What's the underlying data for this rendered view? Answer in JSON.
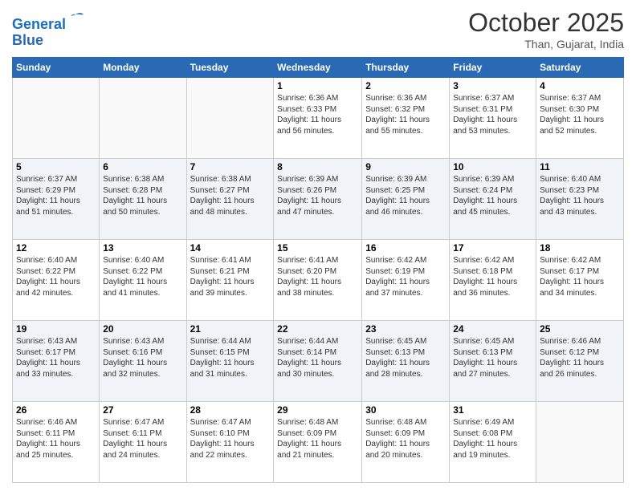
{
  "header": {
    "logo_line1": "General",
    "logo_line2": "Blue",
    "month_title": "October 2025",
    "location": "Than, Gujarat, India"
  },
  "days_of_week": [
    "Sunday",
    "Monday",
    "Tuesday",
    "Wednesday",
    "Thursday",
    "Friday",
    "Saturday"
  ],
  "weeks": [
    [
      {
        "day": "",
        "content": ""
      },
      {
        "day": "",
        "content": ""
      },
      {
        "day": "",
        "content": ""
      },
      {
        "day": "1",
        "content": "Sunrise: 6:36 AM\nSunset: 6:33 PM\nDaylight: 11 hours and 56 minutes."
      },
      {
        "day": "2",
        "content": "Sunrise: 6:36 AM\nSunset: 6:32 PM\nDaylight: 11 hours and 55 minutes."
      },
      {
        "day": "3",
        "content": "Sunrise: 6:37 AM\nSunset: 6:31 PM\nDaylight: 11 hours and 53 minutes."
      },
      {
        "day": "4",
        "content": "Sunrise: 6:37 AM\nSunset: 6:30 PM\nDaylight: 11 hours and 52 minutes."
      }
    ],
    [
      {
        "day": "5",
        "content": "Sunrise: 6:37 AM\nSunset: 6:29 PM\nDaylight: 11 hours and 51 minutes."
      },
      {
        "day": "6",
        "content": "Sunrise: 6:38 AM\nSunset: 6:28 PM\nDaylight: 11 hours and 50 minutes."
      },
      {
        "day": "7",
        "content": "Sunrise: 6:38 AM\nSunset: 6:27 PM\nDaylight: 11 hours and 48 minutes."
      },
      {
        "day": "8",
        "content": "Sunrise: 6:39 AM\nSunset: 6:26 PM\nDaylight: 11 hours and 47 minutes."
      },
      {
        "day": "9",
        "content": "Sunrise: 6:39 AM\nSunset: 6:25 PM\nDaylight: 11 hours and 46 minutes."
      },
      {
        "day": "10",
        "content": "Sunrise: 6:39 AM\nSunset: 6:24 PM\nDaylight: 11 hours and 45 minutes."
      },
      {
        "day": "11",
        "content": "Sunrise: 6:40 AM\nSunset: 6:23 PM\nDaylight: 11 hours and 43 minutes."
      }
    ],
    [
      {
        "day": "12",
        "content": "Sunrise: 6:40 AM\nSunset: 6:22 PM\nDaylight: 11 hours and 42 minutes."
      },
      {
        "day": "13",
        "content": "Sunrise: 6:40 AM\nSunset: 6:22 PM\nDaylight: 11 hours and 41 minutes."
      },
      {
        "day": "14",
        "content": "Sunrise: 6:41 AM\nSunset: 6:21 PM\nDaylight: 11 hours and 39 minutes."
      },
      {
        "day": "15",
        "content": "Sunrise: 6:41 AM\nSunset: 6:20 PM\nDaylight: 11 hours and 38 minutes."
      },
      {
        "day": "16",
        "content": "Sunrise: 6:42 AM\nSunset: 6:19 PM\nDaylight: 11 hours and 37 minutes."
      },
      {
        "day": "17",
        "content": "Sunrise: 6:42 AM\nSunset: 6:18 PM\nDaylight: 11 hours and 36 minutes."
      },
      {
        "day": "18",
        "content": "Sunrise: 6:42 AM\nSunset: 6:17 PM\nDaylight: 11 hours and 34 minutes."
      }
    ],
    [
      {
        "day": "19",
        "content": "Sunrise: 6:43 AM\nSunset: 6:17 PM\nDaylight: 11 hours and 33 minutes."
      },
      {
        "day": "20",
        "content": "Sunrise: 6:43 AM\nSunset: 6:16 PM\nDaylight: 11 hours and 32 minutes."
      },
      {
        "day": "21",
        "content": "Sunrise: 6:44 AM\nSunset: 6:15 PM\nDaylight: 11 hours and 31 minutes."
      },
      {
        "day": "22",
        "content": "Sunrise: 6:44 AM\nSunset: 6:14 PM\nDaylight: 11 hours and 30 minutes."
      },
      {
        "day": "23",
        "content": "Sunrise: 6:45 AM\nSunset: 6:13 PM\nDaylight: 11 hours and 28 minutes."
      },
      {
        "day": "24",
        "content": "Sunrise: 6:45 AM\nSunset: 6:13 PM\nDaylight: 11 hours and 27 minutes."
      },
      {
        "day": "25",
        "content": "Sunrise: 6:46 AM\nSunset: 6:12 PM\nDaylight: 11 hours and 26 minutes."
      }
    ],
    [
      {
        "day": "26",
        "content": "Sunrise: 6:46 AM\nSunset: 6:11 PM\nDaylight: 11 hours and 25 minutes."
      },
      {
        "day": "27",
        "content": "Sunrise: 6:47 AM\nSunset: 6:11 PM\nDaylight: 11 hours and 24 minutes."
      },
      {
        "day": "28",
        "content": "Sunrise: 6:47 AM\nSunset: 6:10 PM\nDaylight: 11 hours and 22 minutes."
      },
      {
        "day": "29",
        "content": "Sunrise: 6:48 AM\nSunset: 6:09 PM\nDaylight: 11 hours and 21 minutes."
      },
      {
        "day": "30",
        "content": "Sunrise: 6:48 AM\nSunset: 6:09 PM\nDaylight: 11 hours and 20 minutes."
      },
      {
        "day": "31",
        "content": "Sunrise: 6:49 AM\nSunset: 6:08 PM\nDaylight: 11 hours and 19 minutes."
      },
      {
        "day": "",
        "content": ""
      }
    ]
  ]
}
